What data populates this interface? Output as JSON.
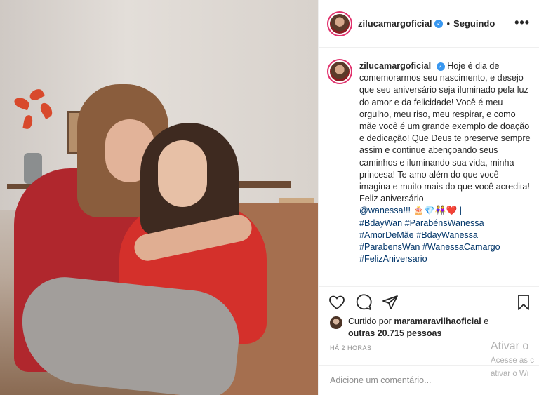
{
  "post": {
    "photo_alt": "",
    "header": {
      "username": "zilucamargoficial",
      "separator": "•",
      "following_label": "Seguindo",
      "more_icon": "more-options-icon",
      "more_label": "•••"
    },
    "caption": {
      "username": "zilucamargoficial",
      "text": "Hoje é dia de comemorarmos seu nascimento, e desejo que seu aniversário seja iluminado pela luz do amor e da felicidade! Você é meu orgulho, meu riso, meu respirar, e como mãe você é um grande exemplo de doação e dedicação! Que Deus te preserve sempre assim e continue abençoando seus caminhos e iluminando sua vida, minha princesa! Te amo além do que você imagina e muito mais do que você acredita! Feliz aniversário",
      "mention_line": "@wanessa!!! 🎂💎👭❤️ |",
      "hashtags": "#BdayWan #ParabénsWanessa #AmorDeMãe #BdayWanessa #ParabensWan #WanessaCamargo #FelizAniversario"
    },
    "likes": {
      "prefix": "Curtido por",
      "liker": "maramaravilhaoficial",
      "connector": "e",
      "others": "outras 20.715 pessoas"
    },
    "time": "HÁ 2 HORAS",
    "comment_placeholder": "Adicione um comentário..."
  },
  "watermark": {
    "line1": "Ativar o",
    "line2": "Acesse as c",
    "line3": "ativar o Wi"
  },
  "colors": {
    "verified": "#3897f0",
    "hashtag": "#003569",
    "muted": "#8e8e8e",
    "avatar_ring": "#e1306c"
  }
}
